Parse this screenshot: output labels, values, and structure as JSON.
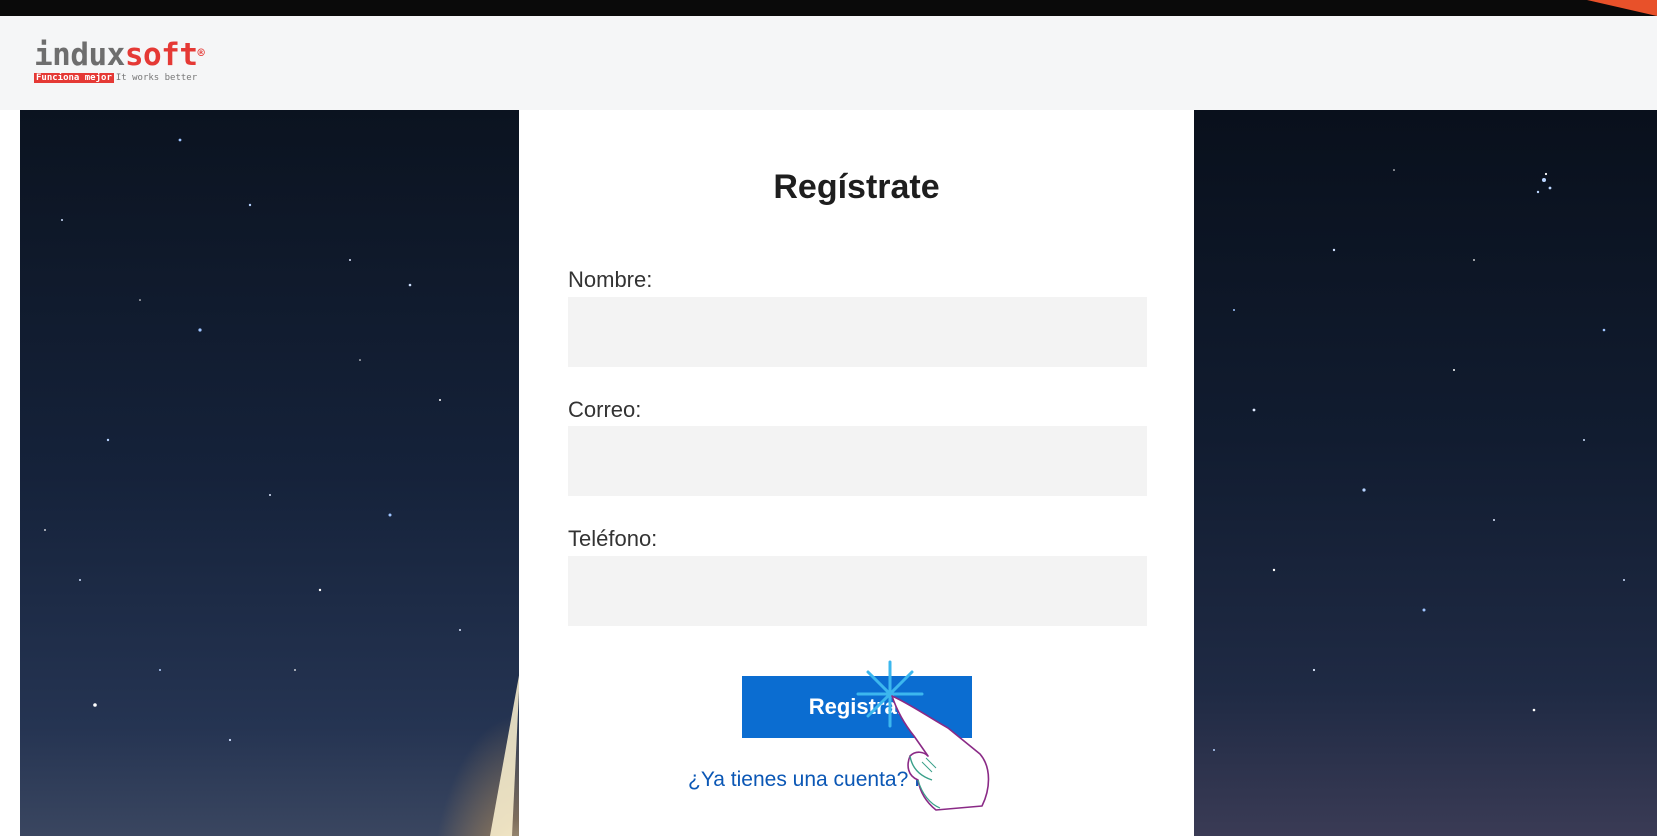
{
  "brand": {
    "name_part1": "indux",
    "name_part2": "soft",
    "registered_mark": "®",
    "tagline_highlight": "Funciona mejor",
    "tagline_rest": "It works better",
    "accent_color": "#e53935"
  },
  "form": {
    "title": "Regístrate",
    "fields": [
      {
        "label": "Nombre:",
        "value": ""
      },
      {
        "label": "Correo:",
        "value": ""
      },
      {
        "label": "Teléfono:",
        "value": ""
      }
    ],
    "submit_label": "Registrar",
    "login_link": "¿Ya tienes una cuenta? In"
  },
  "colors": {
    "primary_button": "#0b6dd1",
    "link": "#0b57b5",
    "input_bg": "#f3f3f3"
  },
  "icons": {
    "tap_gesture": "hand-pointer-icon",
    "tap_burst": "tap-burst-icon"
  }
}
